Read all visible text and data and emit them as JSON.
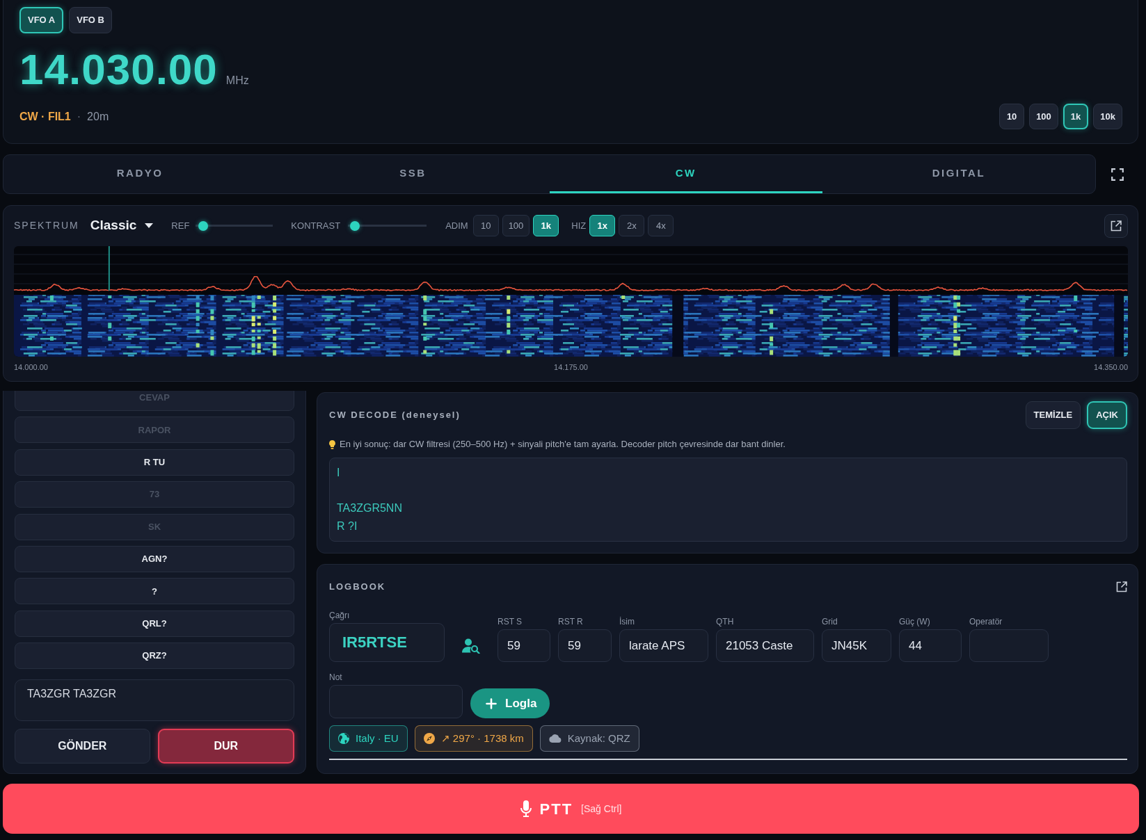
{
  "vfo": {
    "selectors": [
      {
        "label": "VFO A",
        "selected": true
      },
      {
        "label": "VFO B",
        "selected": false
      }
    ],
    "frequency": "14.030.00",
    "unit": "MHz",
    "mode": "CW · FIL1",
    "separator": "·",
    "band": "20m",
    "steps": [
      {
        "label": "10",
        "selected": false
      },
      {
        "label": "100",
        "selected": false
      },
      {
        "label": "1k",
        "selected": true
      },
      {
        "label": "10k",
        "selected": false
      }
    ]
  },
  "tabs": [
    {
      "label": "RADYO",
      "selected": false
    },
    {
      "label": "SSB",
      "selected": false
    },
    {
      "label": "CW",
      "selected": true
    },
    {
      "label": "DIGITAL",
      "selected": false
    }
  ],
  "spectrum": {
    "title": "SPEKTRUM",
    "palette": "Classic",
    "sliders": [
      {
        "label": "REF",
        "level": 0.04
      },
      {
        "label": "KONTRAST",
        "level": 0.03
      }
    ],
    "step_label": "ADIM",
    "steps": [
      {
        "label": "10",
        "selected": false
      },
      {
        "label": "100",
        "selected": false
      },
      {
        "label": "1k",
        "selected": true
      }
    ],
    "speed_label": "HIZ",
    "speeds": [
      {
        "label": "1x",
        "selected": true
      },
      {
        "label": "2x",
        "selected": false
      },
      {
        "label": "4x",
        "selected": false
      }
    ],
    "axis_labels": [
      "14.000.00",
      "14.175.00",
      "14.350.00"
    ]
  },
  "macros": {
    "buttons": [
      {
        "label": "CEVAP",
        "disabled": true
      },
      {
        "label": "RAPOR",
        "disabled": true
      },
      {
        "label": "R TU",
        "disabled": false
      },
      {
        "label": "73",
        "disabled": true
      },
      {
        "label": "SK",
        "disabled": true
      },
      {
        "label": "AGN?",
        "disabled": false
      },
      {
        "label": "?",
        "disabled": false
      },
      {
        "label": "QRL?",
        "disabled": false
      },
      {
        "label": "QRZ?",
        "disabled": false
      }
    ],
    "message": "TA3ZGR TA3ZGR",
    "send": "GÖNDER",
    "stop": "DUR"
  },
  "cw_decode": {
    "title": "CW DECODE (deneysel)",
    "buttons": [
      {
        "label": "TEMİZLE",
        "selected": false
      },
      {
        "label": "AÇIK",
        "selected": true
      }
    ],
    "hint": "En iyi sonuç: dar CW filtresi (250–500 Hz) + sinyali pitch'e tam ayarla. Decoder pitch çevresinde dar bant dinler.",
    "output": "I\n\nTA3ZGR5NN\nR ?I"
  },
  "logbook": {
    "title": "LOGBOOK",
    "fields": [
      {
        "label": "Çağrı",
        "value": "IR5RTSE",
        "kind": "callsign"
      },
      {
        "label": "RST S",
        "value": "59",
        "kind": "text"
      },
      {
        "label": "RST R",
        "value": "59",
        "kind": "text"
      },
      {
        "label": "İsim",
        "value": "larate APS",
        "kind": "text"
      },
      {
        "label": "QTH",
        "value": "21053 Caste",
        "kind": "text"
      },
      {
        "label": "Grid",
        "value": "JN45K",
        "kind": "text"
      },
      {
        "label": "Güç (W)",
        "value": "44",
        "kind": "text"
      },
      {
        "label": "Operatör",
        "kind": "text"
      }
    ],
    "note_label": "Not",
    "log_button": "Logla",
    "tags": [
      {
        "text": "Italy · EU",
        "kind": "region",
        "color": "#2dd4bf"
      },
      {
        "text": "↗ 297° · 1738 km",
        "kind": "bearing",
        "color": "#f0a848"
      },
      {
        "text": "Kaynak: QRZ",
        "kind": "source",
        "color": "#9aa3b2"
      }
    ]
  },
  "ptt": {
    "label": "PTT",
    "shortcut": "[Sağ Ctrl]"
  }
}
